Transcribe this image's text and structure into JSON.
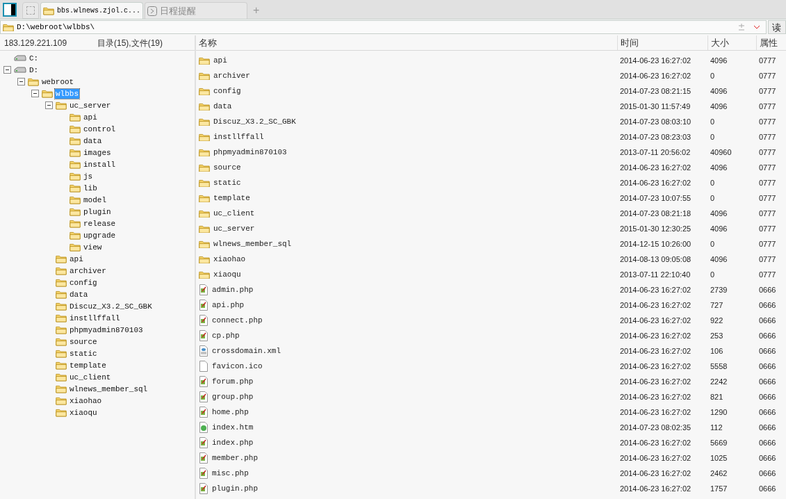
{
  "tabs": [
    {
      "label": "bbs.wlnews.zjol.c...",
      "kind": "folder",
      "selected": true
    },
    {
      "label": "日程提醒",
      "kind": "schedule",
      "selected": false
    }
  ],
  "new_tab": "+",
  "address_bar": {
    "value": "D:\\webroot\\wlbbs\\",
    "button": "读"
  },
  "left_header": {
    "host": "183.129.221.109",
    "summary": "目录(15),文件(19)"
  },
  "tree": [
    {
      "label": "C:",
      "kind": "drive",
      "selected": false
    },
    {
      "label": "D:",
      "kind": "drive",
      "selected": false,
      "expanded": true,
      "children": [
        {
          "label": "webroot",
          "kind": "folder",
          "selected": false,
          "expanded": true,
          "children": [
            {
              "label": "wlbbs",
              "kind": "folder",
              "selected": true,
              "expanded": true,
              "children": [
                {
                  "label": "uc_server",
                  "kind": "folder",
                  "selected": false,
                  "expanded": true,
                  "children": [
                    {
                      "label": "api",
                      "kind": "folder",
                      "selected": false
                    },
                    {
                      "label": "control",
                      "kind": "folder",
                      "selected": false
                    },
                    {
                      "label": "data",
                      "kind": "folder",
                      "selected": false
                    },
                    {
                      "label": "images",
                      "kind": "folder",
                      "selected": false
                    },
                    {
                      "label": "install",
                      "kind": "folder",
                      "selected": false
                    },
                    {
                      "label": "js",
                      "kind": "folder",
                      "selected": false
                    },
                    {
                      "label": "lib",
                      "kind": "folder",
                      "selected": false
                    },
                    {
                      "label": "model",
                      "kind": "folder",
                      "selected": false
                    },
                    {
                      "label": "plugin",
                      "kind": "folder",
                      "selected": false
                    },
                    {
                      "label": "release",
                      "kind": "folder",
                      "selected": false
                    },
                    {
                      "label": "upgrade",
                      "kind": "folder",
                      "selected": false
                    },
                    {
                      "label": "view",
                      "kind": "folder",
                      "selected": false
                    }
                  ]
                },
                {
                  "label": "api",
                  "kind": "folder",
                  "selected": false
                },
                {
                  "label": "archiver",
                  "kind": "folder",
                  "selected": false
                },
                {
                  "label": "config",
                  "kind": "folder",
                  "selected": false
                },
                {
                  "label": "data",
                  "kind": "folder",
                  "selected": false
                },
                {
                  "label": "Discuz_X3.2_SC_GBK",
                  "kind": "folder",
                  "selected": false
                },
                {
                  "label": "instllffall",
                  "kind": "folder",
                  "selected": false
                },
                {
                  "label": "phpmyadmin870103",
                  "kind": "folder",
                  "selected": false
                },
                {
                  "label": "source",
                  "kind": "folder",
                  "selected": false
                },
                {
                  "label": "static",
                  "kind": "folder",
                  "selected": false
                },
                {
                  "label": "template",
                  "kind": "folder",
                  "selected": false
                },
                {
                  "label": "uc_client",
                  "kind": "folder",
                  "selected": false
                },
                {
                  "label": "wlnews_member_sql",
                  "kind": "folder",
                  "selected": false
                },
                {
                  "label": "xiaohao",
                  "kind": "folder",
                  "selected": false
                },
                {
                  "label": "xiaoqu",
                  "kind": "folder",
                  "selected": false
                }
              ]
            }
          ]
        }
      ]
    }
  ],
  "table": {
    "columns": [
      "名称",
      "时间",
      "大小",
      "属性"
    ],
    "rows": [
      {
        "kind": "folder",
        "name": "api",
        "time": "2014-06-23 16:27:02",
        "size": "4096",
        "attr": "0777"
      },
      {
        "kind": "folder",
        "name": "archiver",
        "time": "2014-06-23 16:27:02",
        "size": "0",
        "attr": "0777"
      },
      {
        "kind": "folder",
        "name": "config",
        "time": "2014-07-23 08:21:15",
        "size": "4096",
        "attr": "0777"
      },
      {
        "kind": "folder",
        "name": "data",
        "time": "2015-01-30 11:57:49",
        "size": "4096",
        "attr": "0777"
      },
      {
        "kind": "folder",
        "name": "Discuz_X3.2_SC_GBK",
        "time": "2014-07-23 08:03:10",
        "size": "0",
        "attr": "0777"
      },
      {
        "kind": "folder",
        "name": "instllffall",
        "time": "2014-07-23 08:23:03",
        "size": "0",
        "attr": "0777"
      },
      {
        "kind": "folder",
        "name": "phpmyadmin870103",
        "time": "2013-07-11 20:56:02",
        "size": "40960",
        "attr": "0777"
      },
      {
        "kind": "folder",
        "name": "source",
        "time": "2014-06-23 16:27:02",
        "size": "4096",
        "attr": "0777"
      },
      {
        "kind": "folder",
        "name": "static",
        "time": "2014-06-23 16:27:02",
        "size": "0",
        "attr": "0777"
      },
      {
        "kind": "folder",
        "name": "template",
        "time": "2014-07-23 10:07:55",
        "size": "0",
        "attr": "0777"
      },
      {
        "kind": "folder",
        "name": "uc_client",
        "time": "2014-07-23 08:21:18",
        "size": "4096",
        "attr": "0777"
      },
      {
        "kind": "folder",
        "name": "uc_server",
        "time": "2015-01-30 12:30:25",
        "size": "4096",
        "attr": "0777"
      },
      {
        "kind": "folder",
        "name": "wlnews_member_sql",
        "time": "2014-12-15 10:26:00",
        "size": "0",
        "attr": "0777"
      },
      {
        "kind": "folder",
        "name": "xiaohao",
        "time": "2014-08-13 09:05:08",
        "size": "4096",
        "attr": "0777"
      },
      {
        "kind": "folder",
        "name": "xiaoqu",
        "time": "2013-07-11 22:10:40",
        "size": "0",
        "attr": "0777"
      },
      {
        "kind": "script",
        "name": "admin.php",
        "time": "2014-06-23 16:27:02",
        "size": "2739",
        "attr": "0666"
      },
      {
        "kind": "script",
        "name": "api.php",
        "time": "2014-06-23 16:27:02",
        "size": "727",
        "attr": "0666"
      },
      {
        "kind": "script",
        "name": "connect.php",
        "time": "2014-06-23 16:27:02",
        "size": "922",
        "attr": "0666"
      },
      {
        "kind": "script",
        "name": "cp.php",
        "time": "2014-06-23 16:27:02",
        "size": "253",
        "attr": "0666"
      },
      {
        "kind": "xml",
        "name": "crossdomain.xml",
        "time": "2014-06-23 16:27:02",
        "size": "106",
        "attr": "0666"
      },
      {
        "kind": "blank",
        "name": "favicon.ico",
        "time": "2014-06-23 16:27:02",
        "size": "5558",
        "attr": "0666"
      },
      {
        "kind": "script",
        "name": "forum.php",
        "time": "2014-06-23 16:27:02",
        "size": "2242",
        "attr": "0666"
      },
      {
        "kind": "script",
        "name": "group.php",
        "time": "2014-06-23 16:27:02",
        "size": "821",
        "attr": "0666"
      },
      {
        "kind": "script",
        "name": "home.php",
        "time": "2014-06-23 16:27:02",
        "size": "1290",
        "attr": "0666"
      },
      {
        "kind": "html",
        "name": "index.htm",
        "time": "2014-07-23 08:02:35",
        "size": "112",
        "attr": "0666"
      },
      {
        "kind": "script",
        "name": "index.php",
        "time": "2014-06-23 16:27:02",
        "size": "5669",
        "attr": "0666"
      },
      {
        "kind": "script",
        "name": "member.php",
        "time": "2014-06-23 16:27:02",
        "size": "1025",
        "attr": "0666"
      },
      {
        "kind": "script",
        "name": "misc.php",
        "time": "2014-06-23 16:27:02",
        "size": "2462",
        "attr": "0666"
      },
      {
        "kind": "script",
        "name": "plugin.php",
        "time": "2014-06-23 16:27:02",
        "size": "1757",
        "attr": "0666"
      }
    ]
  }
}
